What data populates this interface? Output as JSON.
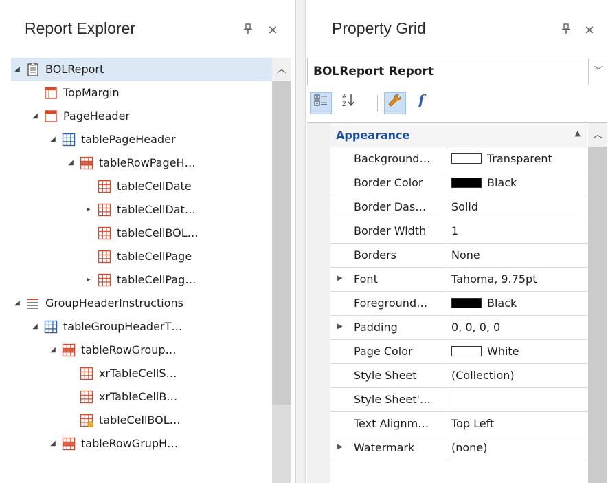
{
  "report_explorer": {
    "title": "Report Explorer",
    "pin_icon": "pin-icon",
    "close_icon": "close-icon",
    "tree": [
      {
        "label": "BOLReport",
        "icon": "report-icon",
        "expander": "expanded",
        "selected": true
      },
      {
        "label": "TopMargin",
        "icon": "margin-band-icon",
        "expander": "none"
      },
      {
        "label": "PageHeader",
        "icon": "page-header-band-icon",
        "expander": "expanded"
      },
      {
        "label": "tablePageHeader",
        "icon": "table-icon",
        "expander": "expanded"
      },
      {
        "label": "tableRowPageH…",
        "icon": "table-row-icon",
        "expander": "expanded"
      },
      {
        "label": "tableCellDate",
        "icon": "table-cell-icon",
        "expander": "none"
      },
      {
        "label": "tableCellDat…",
        "icon": "table-cell-icon",
        "expander": "collapsed"
      },
      {
        "label": "tableCellBOL…",
        "icon": "table-cell-icon",
        "expander": "none"
      },
      {
        "label": "tableCellPage",
        "icon": "table-cell-icon",
        "expander": "none"
      },
      {
        "label": "tableCellPag…",
        "icon": "table-cell-icon",
        "expander": "collapsed"
      },
      {
        "label": "GroupHeaderInstructions",
        "icon": "group-header-band-icon",
        "expander": "expanded"
      },
      {
        "label": "tableGroupHeaderT…",
        "icon": "table-icon",
        "expander": "expanded"
      },
      {
        "label": "tableRowGroup…",
        "icon": "table-row-icon",
        "expander": "expanded"
      },
      {
        "label": "xrTableCellS…",
        "icon": "table-cell-icon",
        "expander": "none"
      },
      {
        "label": "xrTableCellB…",
        "icon": "table-cell-icon",
        "expander": "none"
      },
      {
        "label": "tableCellBOL…",
        "icon": "table-cell-bound-icon",
        "expander": "none"
      },
      {
        "label": "tableRowGrupH…",
        "icon": "table-row-icon",
        "expander": "expanded"
      }
    ],
    "tree_levels": [
      0,
      1,
      1,
      2,
      3,
      4,
      4,
      4,
      4,
      4,
      0,
      1,
      2,
      3,
      3,
      3,
      2
    ]
  },
  "property_grid": {
    "title": "Property Grid",
    "pin_icon": "pin-icon",
    "close_icon": "close-icon",
    "selected_object": {
      "name": "BOLReport",
      "type": "Report"
    },
    "toolbar": [
      {
        "name": "categorized-view-icon",
        "active": true
      },
      {
        "name": "alphabetical-sort-icon",
        "active": false
      },
      {
        "name": "properties-wrench-icon",
        "active": true
      },
      {
        "name": "expressions-function-icon",
        "active": false
      }
    ],
    "category": "Appearance",
    "properties": [
      {
        "name": "Background…",
        "value": "Transparent",
        "swatch": "#ffffff",
        "expandable": false
      },
      {
        "name": "Border Color",
        "value": "Black",
        "swatch": "#000000",
        "expandable": false
      },
      {
        "name": "Border Das…",
        "value": "Solid",
        "expandable": false
      },
      {
        "name": "Border Width",
        "value": "1",
        "expandable": false
      },
      {
        "name": "Borders",
        "value": "None",
        "expandable": false
      },
      {
        "name": "Font",
        "value": "Tahoma, 9.75pt",
        "expandable": true
      },
      {
        "name": "Foreground…",
        "value": "Black",
        "swatch": "#000000",
        "expandable": false
      },
      {
        "name": "Padding",
        "value": "0, 0, 0, 0",
        "expandable": true
      },
      {
        "name": "Page Color",
        "value": "White",
        "swatch": "#ffffff",
        "expandable": false
      },
      {
        "name": "Style Sheet",
        "value": "(Collection)",
        "expandable": false
      },
      {
        "name": "Style Sheet'…",
        "value": "",
        "expandable": false
      },
      {
        "name": "Text Alignm…",
        "value": "Top Left",
        "expandable": false
      },
      {
        "name": "Watermark",
        "value": "(none)",
        "expandable": true
      }
    ]
  },
  "colors": {
    "selection": "#dce8f6",
    "category_text": "#1e4f9c",
    "icon_red": "#d04a2e",
    "icon_blue": "#2f5fa8"
  }
}
